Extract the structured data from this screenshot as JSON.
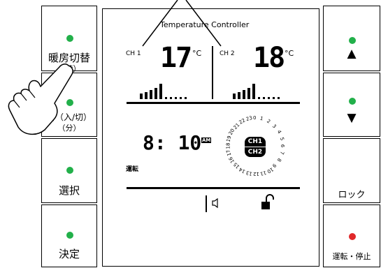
{
  "colors": {
    "led_green": "#22b04a",
    "led_red": "#e0282a",
    "line": "#000000"
  },
  "left_buttons": [
    {
      "label": "暖房切替",
      "sub": "（時）",
      "led": "green"
    },
    {
      "label": "省（入/切）",
      "sub": "（分）",
      "led": "green"
    },
    {
      "label": "選択",
      "sub": "",
      "led": "green"
    },
    {
      "label": "決定",
      "sub": "",
      "led": "green"
    }
  ],
  "right_buttons": [
    {
      "label": "▲",
      "led": "green",
      "icon": "up-triangle-icon"
    },
    {
      "label": "▼",
      "led": "green",
      "icon": "down-triangle-icon"
    },
    {
      "label": "ロック",
      "led": "none"
    },
    {
      "label": "運転・停止",
      "led": "red"
    }
  ],
  "display": {
    "title": "Temperature Controller",
    "ch1": {
      "label": "CH 1",
      "temp": "17",
      "unit": "°C",
      "level": 5
    },
    "ch2": {
      "label": "CH 2",
      "temp": "18",
      "unit": "°C",
      "level": 5
    },
    "clock": {
      "time": "8: 10",
      "ampm": "AM"
    },
    "status": "運転",
    "dial": {
      "ch_top": "CH1",
      "ch_bottom": "CH2",
      "hours": [
        "0",
        "1",
        "2",
        "3",
        "4",
        "5",
        "6",
        "7",
        "8",
        "9",
        "10",
        "11",
        "12",
        "13",
        "14",
        "15",
        "16",
        "17",
        "18",
        "19",
        "20",
        "21",
        "22",
        "23"
      ]
    },
    "icons": [
      "speaker-icon",
      "unlock-icon"
    ]
  },
  "overlay": {
    "icon": "hand-pointer-icon"
  }
}
